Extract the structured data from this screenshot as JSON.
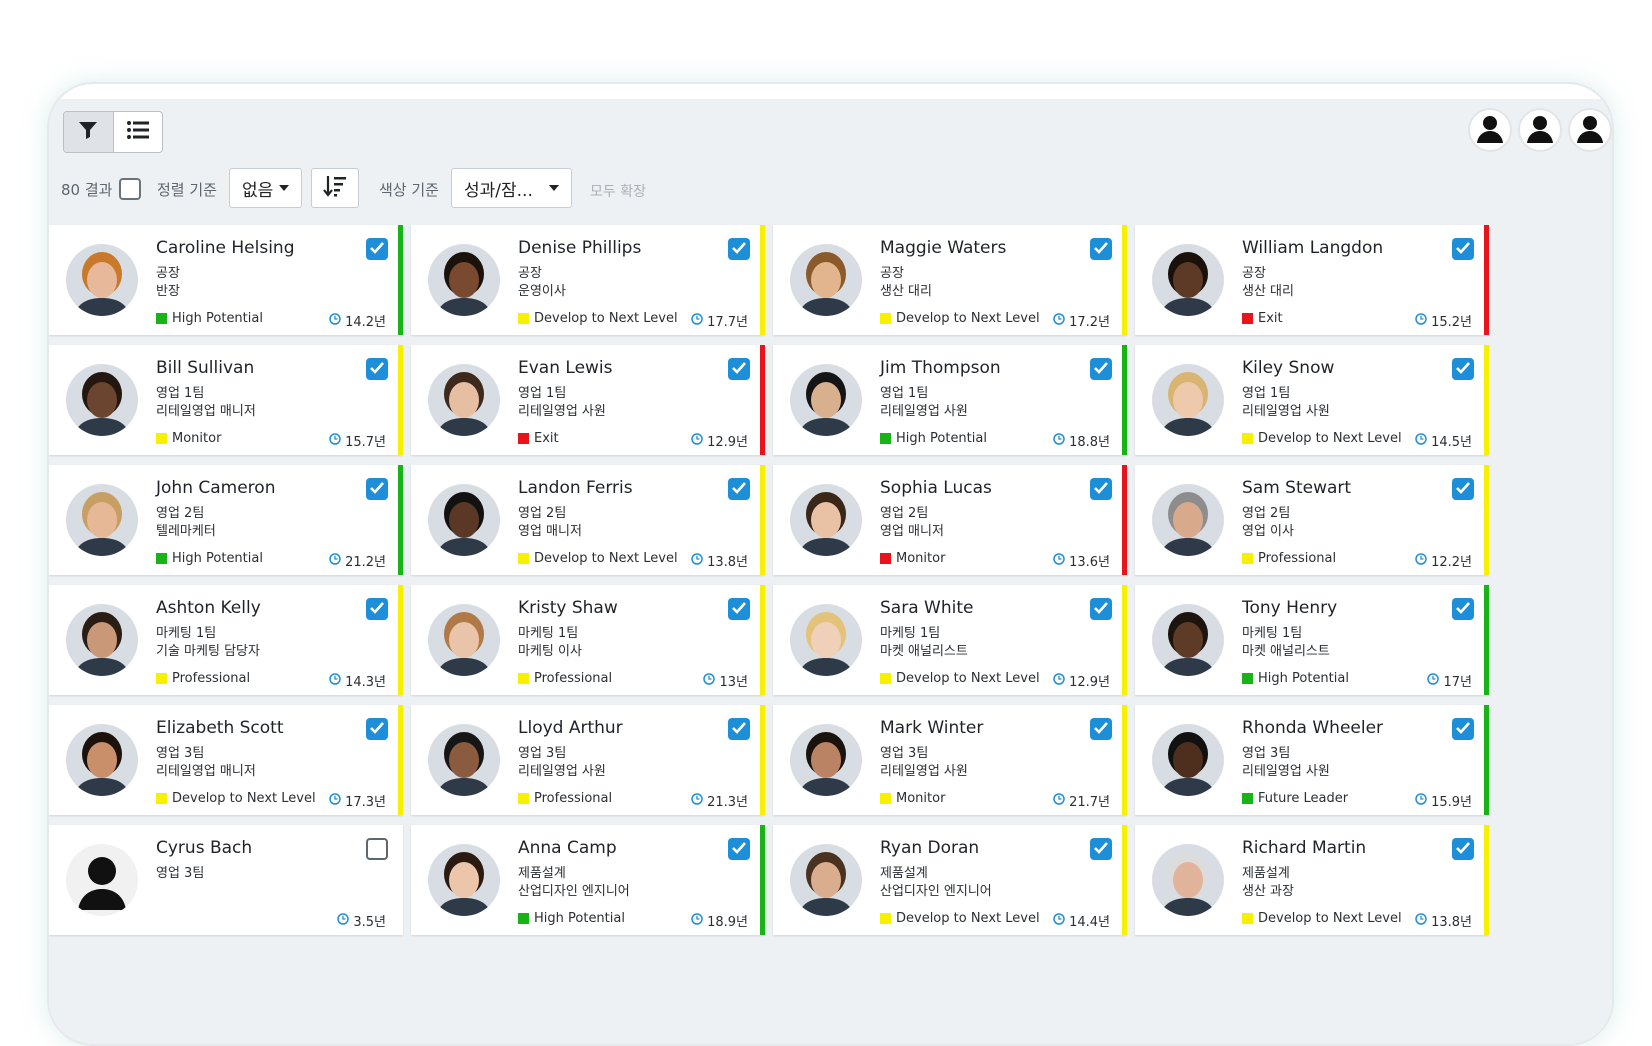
{
  "toolbar": {
    "results_label": "80 결과",
    "sort_label": "정렬 기준",
    "sort_value": "없음",
    "color_label": "색상 기준",
    "color_value": "성과/잠...",
    "expand_all_label": "모두 확장"
  },
  "colors": {
    "accent": "#1d8fd8",
    "green": "#17b317",
    "yellow": "#f7f000",
    "red": "#e8141b"
  },
  "cards": [
    {
      "name": "Caroline Helsing",
      "line1": "공장",
      "line2": "반장",
      "status": "High Potential",
      "color": "green",
      "tenure": "14.2년",
      "checked": true,
      "skin": "#e8b89a",
      "hair": "#c9792a"
    },
    {
      "name": "Denise Phillips",
      "line1": "공장",
      "line2": "운영이사",
      "status": "Develop to Next Level",
      "color": "yellow",
      "tenure": "17.7년",
      "checked": true,
      "skin": "#7a4a30",
      "hair": "#1b120c"
    },
    {
      "name": "Maggie Waters",
      "line1": "공장",
      "line2": "생산 대리",
      "status": "Develop to Next Level",
      "color": "yellow",
      "tenure": "17.2년",
      "checked": true,
      "skin": "#e2b58f",
      "hair": "#8a5a2b"
    },
    {
      "name": "William Langdon",
      "line1": "공장",
      "line2": "생산 대리",
      "status": "Exit",
      "color": "red",
      "tenure": "15.2년",
      "checked": true,
      "skin": "#5c3a25",
      "hair": "#1a110b"
    },
    {
      "name": "Bill Sullivan",
      "line1": "영업 1팀",
      "line2": "리테일영업 매니저",
      "status": "Monitor",
      "color": "yellow",
      "tenure": "15.7년",
      "checked": true,
      "skin": "#6b4530",
      "hair": "#23170f"
    },
    {
      "name": "Evan Lewis",
      "line1": "영업 1팀",
      "line2": "리테일영업 사원",
      "status": "Exit",
      "color": "red",
      "tenure": "12.9년",
      "checked": true,
      "skin": "#e6bfa3",
      "hair": "#3d2a1c"
    },
    {
      "name": "Jim Thompson",
      "line1": "영업 1팀",
      "line2": "리테일영업 사원",
      "status": "High Potential",
      "color": "green",
      "tenure": "18.8년",
      "checked": true,
      "skin": "#d9b08e",
      "hair": "#151515"
    },
    {
      "name": "Kiley Snow",
      "line1": "영업 1팀",
      "line2": "리테일영업 사원",
      "status": "Develop to Next Level",
      "color": "yellow",
      "tenure": "14.5년",
      "checked": true,
      "skin": "#efc9ac",
      "hair": "#d9b571"
    },
    {
      "name": "John Cameron",
      "line1": "영업 2팀",
      "line2": "텔레마케터",
      "status": "High Potential",
      "color": "green",
      "tenure": "21.2년",
      "checked": true,
      "skin": "#e7b896",
      "hair": "#c79f63"
    },
    {
      "name": "Landon Ferris",
      "line1": "영업 2팀",
      "line2": "영업 매니저",
      "status": "Develop to Next Level",
      "color": "yellow",
      "tenure": "13.8년",
      "checked": true,
      "skin": "#5a3825",
      "hair": "#121212"
    },
    {
      "name": "Sophia Lucas",
      "line1": "영업 2팀",
      "line2": "영업 매니저",
      "status": "Monitor",
      "color": "red",
      "tenure": "13.6년",
      "checked": true,
      "skin": "#e9c2a6",
      "hair": "#3a2718"
    },
    {
      "name": "Sam Stewart",
      "line1": "영업 2팀",
      "line2": "영업 이사",
      "status": "Professional",
      "color": "yellow",
      "tenure": "12.2년",
      "checked": true,
      "skin": "#d8a98a",
      "hair": "#8d8d8d"
    },
    {
      "name": "Ashton Kelly",
      "line1": "마케팅 1팀",
      "line2": "기술 마케팅 담당자",
      "status": "Professional",
      "color": "yellow",
      "tenure": "14.3년",
      "checked": true,
      "skin": "#c89878",
      "hair": "#2a1d14"
    },
    {
      "name": "Kristy Shaw",
      "line1": "마케팅 1팀",
      "line2": "마케팅 이사",
      "status": "Professional",
      "color": "yellow",
      "tenure": "13년",
      "checked": true,
      "skin": "#eac4a8",
      "hair": "#b07a48"
    },
    {
      "name": "Sara White",
      "line1": "마케팅 1팀",
      "line2": "마켓 애널리스트",
      "status": "Develop to Next Level",
      "color": "yellow",
      "tenure": "12.9년",
      "checked": true,
      "skin": "#f0d0b8",
      "hair": "#e3c27a"
    },
    {
      "name": "Tony Henry",
      "line1": "마케팅 1팀",
      "line2": "마켓 애널리스트",
      "status": "High Potential",
      "color": "green",
      "tenure": "17년",
      "checked": true,
      "skin": "#5e3b26",
      "hair": "#1d140e"
    },
    {
      "name": "Elizabeth Scott",
      "line1": "영업 3팀",
      "line2": "리테일영업 매니저",
      "status": "Develop to Next Level",
      "color": "yellow",
      "tenure": "17.3년",
      "checked": true,
      "skin": "#c98e6a",
      "hair": "#1c120b"
    },
    {
      "name": "Lloyd Arthur",
      "line1": "영업 3팀",
      "line2": "리테일영업 사원",
      "status": "Professional",
      "color": "yellow",
      "tenure": "21.3년",
      "checked": true,
      "skin": "#8a5b3e",
      "hair": "#161616"
    },
    {
      "name": "Mark Winter",
      "line1": "영업 3팀",
      "line2": "리테일영업 사원",
      "status": "Monitor",
      "color": "yellow",
      "tenure": "21.7년",
      "checked": true,
      "skin": "#b98364",
      "hair": "#1a120c"
    },
    {
      "name": "Rhonda Wheeler",
      "line1": "영업 3팀",
      "line2": "리테일영업 사원",
      "status": "Future Leader",
      "color": "green",
      "tenure": "15.9년",
      "checked": true,
      "skin": "#4e2f1d",
      "hair": "#111111"
    },
    {
      "name": "Cyrus Bach",
      "line1": "영업 3팀",
      "line2": "",
      "status": "",
      "color": "none",
      "tenure": "3.5년",
      "checked": false,
      "skin": "",
      "hair": ""
    },
    {
      "name": "Anna Camp",
      "line1": "제품설계",
      "line2": "산업디자인 엔지니어",
      "status": "High Potential",
      "color": "green",
      "tenure": "18.9년",
      "checked": true,
      "skin": "#ecc6aa",
      "hair": "#2a1a10"
    },
    {
      "name": "Ryan Doran",
      "line1": "제품설계",
      "line2": "산업디자인 엔지니어",
      "status": "Develop to Next Level",
      "color": "yellow",
      "tenure": "14.4년",
      "checked": true,
      "skin": "#d9ad8d",
      "hair": "#4a3220"
    },
    {
      "name": "Richard Martin",
      "line1": "제품설계",
      "line2": "생산 과장",
      "status": "Develop to Next Level",
      "color": "yellow",
      "tenure": "13.8년",
      "checked": true,
      "skin": "#e0b39a",
      "hair": "#dcdcdc"
    }
  ]
}
